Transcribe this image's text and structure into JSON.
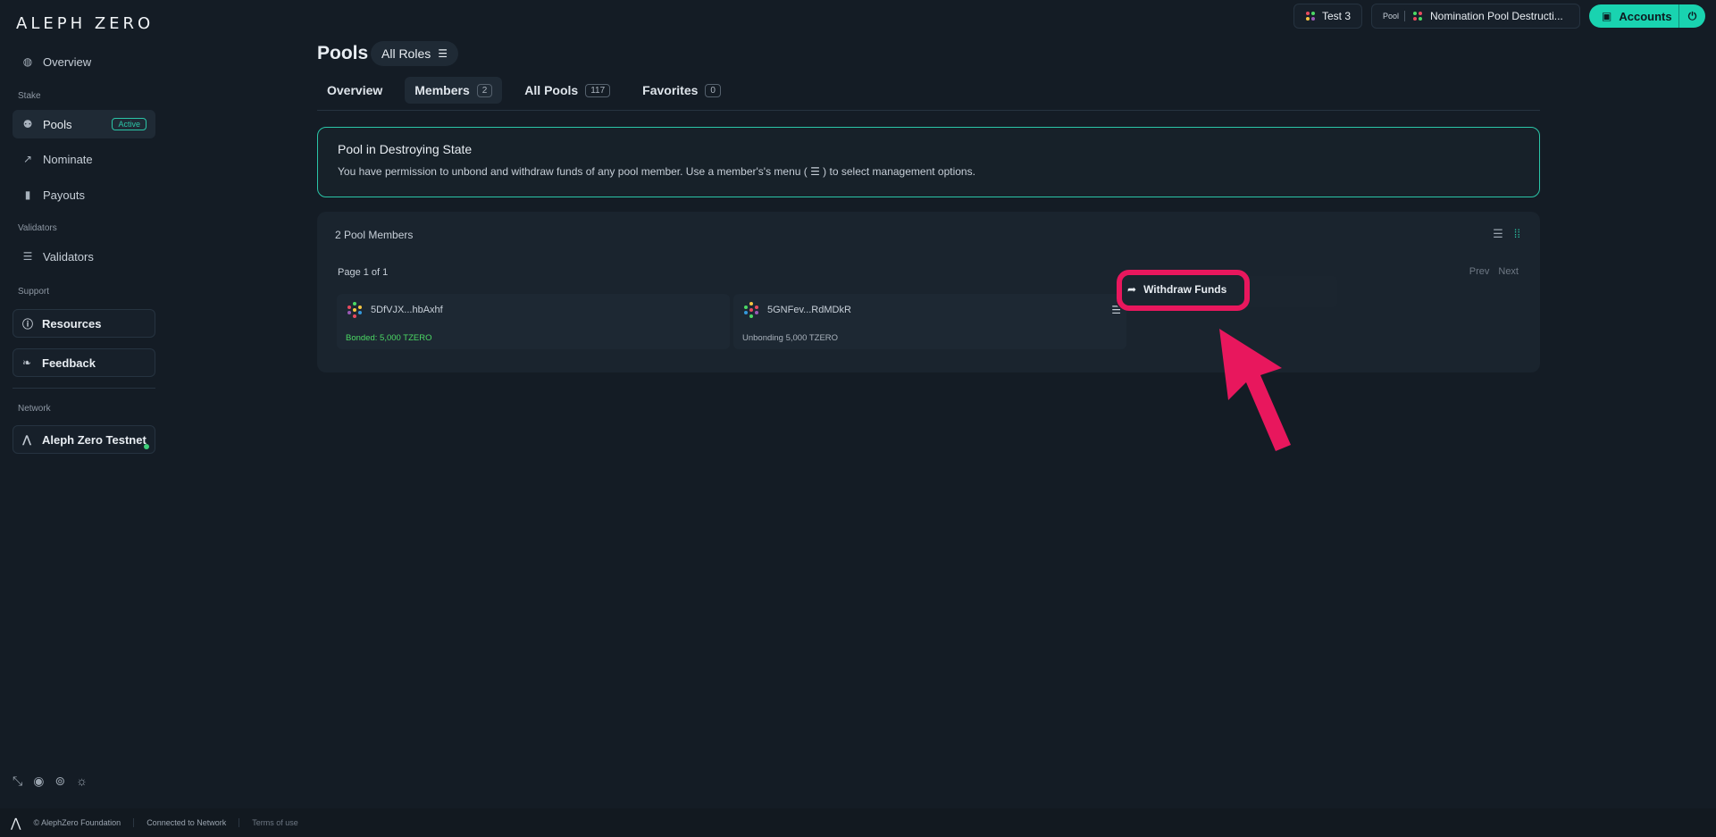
{
  "brand": {
    "logo": "ALEPH ZERO"
  },
  "sidebar": {
    "overview": "Overview",
    "stake_label": "Stake",
    "pools": "Pools",
    "pools_badge": "Active",
    "nominate": "Nominate",
    "payouts": "Payouts",
    "validators_label": "Validators",
    "validators": "Validators",
    "support_label": "Support",
    "resources": "Resources",
    "feedback": "Feedback",
    "network_label": "Network",
    "network": "Aleph Zero Testnet"
  },
  "topbar": {
    "account": "Test 3",
    "pool_tag": "Pool",
    "pool_name": "Nomination Pool Destructi...",
    "accounts": "Accounts"
  },
  "main": {
    "title": "Pools",
    "roles": "All Roles",
    "tabs": [
      {
        "label": "Overview",
        "count": ""
      },
      {
        "label": "Members",
        "count": "2"
      },
      {
        "label": "All Pools",
        "count": "117"
      },
      {
        "label": "Favorites",
        "count": "0"
      }
    ],
    "notice": {
      "title": "Pool in Destroying State",
      "body": "You have permission to unbond and withdraw funds of any pool member. Use a member's's menu ( ☰ ) to select management options."
    },
    "panel_title": "2 Pool Members",
    "page_info": "Page 1 of 1",
    "prev": "Prev",
    "next": "Next",
    "members": [
      {
        "address": "5DfVJX...hbAxhf",
        "status": "Bonded: 5,000 TZERO",
        "status_color": "#4cd964"
      },
      {
        "address": "5GNFev...RdMDkR",
        "status": "Unbonding 5,000 TZERO",
        "status_color": "#aab3bd"
      }
    ],
    "menu_item": "Withdraw Funds"
  },
  "footer": {
    "copyright": "© AlephZero Foundation",
    "connection": "Connected to Network",
    "terms": "Terms of use"
  },
  "colors": {
    "accent": "#19d3b0",
    "highlight": "#e8175d",
    "background": "#141c25"
  },
  "icons": [
    "globe-icon",
    "users-icon",
    "trend-icon",
    "bar-chart-icon",
    "server-icon",
    "info-icon",
    "feedback-icon",
    "aleph-icon",
    "collapse-icon",
    "github-icon",
    "settings-icon",
    "sun-icon",
    "list-icon",
    "grid-icon",
    "share-icon",
    "wallet-icon",
    "plug-icon"
  ]
}
